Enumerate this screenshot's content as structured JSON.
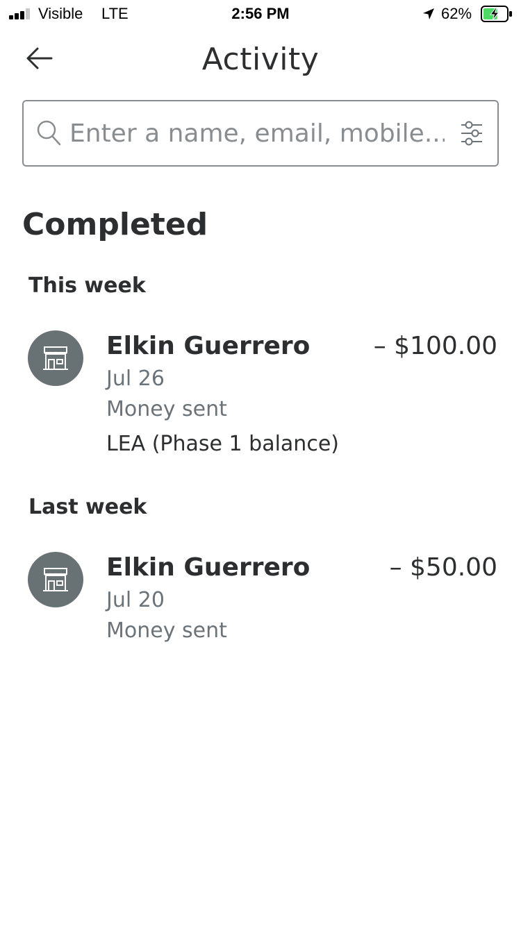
{
  "status_bar": {
    "carrier": "Visible",
    "network": "LTE",
    "time": "2:56 PM",
    "battery_percent": "62%",
    "battery_level": 0.62,
    "battery_color": "#4cd964",
    "icons": [
      "signal-bars-icon",
      "location-arrow-icon",
      "battery-charging-icon"
    ]
  },
  "header": {
    "title": "Activity",
    "back_icon": "arrow-left-icon"
  },
  "search": {
    "placeholder": "Enter a name, email, mobile...",
    "value": "",
    "icons": [
      "search-icon",
      "filter-sliders-icon"
    ]
  },
  "content": {
    "section_title": "Completed",
    "groups": [
      {
        "heading": "This week",
        "transactions": [
          {
            "icon": "storefront-icon",
            "name": "Elkin Guerrero",
            "amount": "– $100.00",
            "date": "Jul 26",
            "type": "Money sent",
            "note": "LEA (Phase 1 balance)"
          }
        ]
      },
      {
        "heading": "Last week",
        "transactions": [
          {
            "icon": "storefront-icon",
            "name": "Elkin Guerrero",
            "amount": "– $50.00",
            "date": "Jul 20",
            "type": "Money sent"
          }
        ]
      }
    ]
  },
  "colors": {
    "text_primary": "#2c2e2f",
    "text_secondary": "#6c7378",
    "avatar_bg": "#687173",
    "border": "#8a8d8f"
  }
}
